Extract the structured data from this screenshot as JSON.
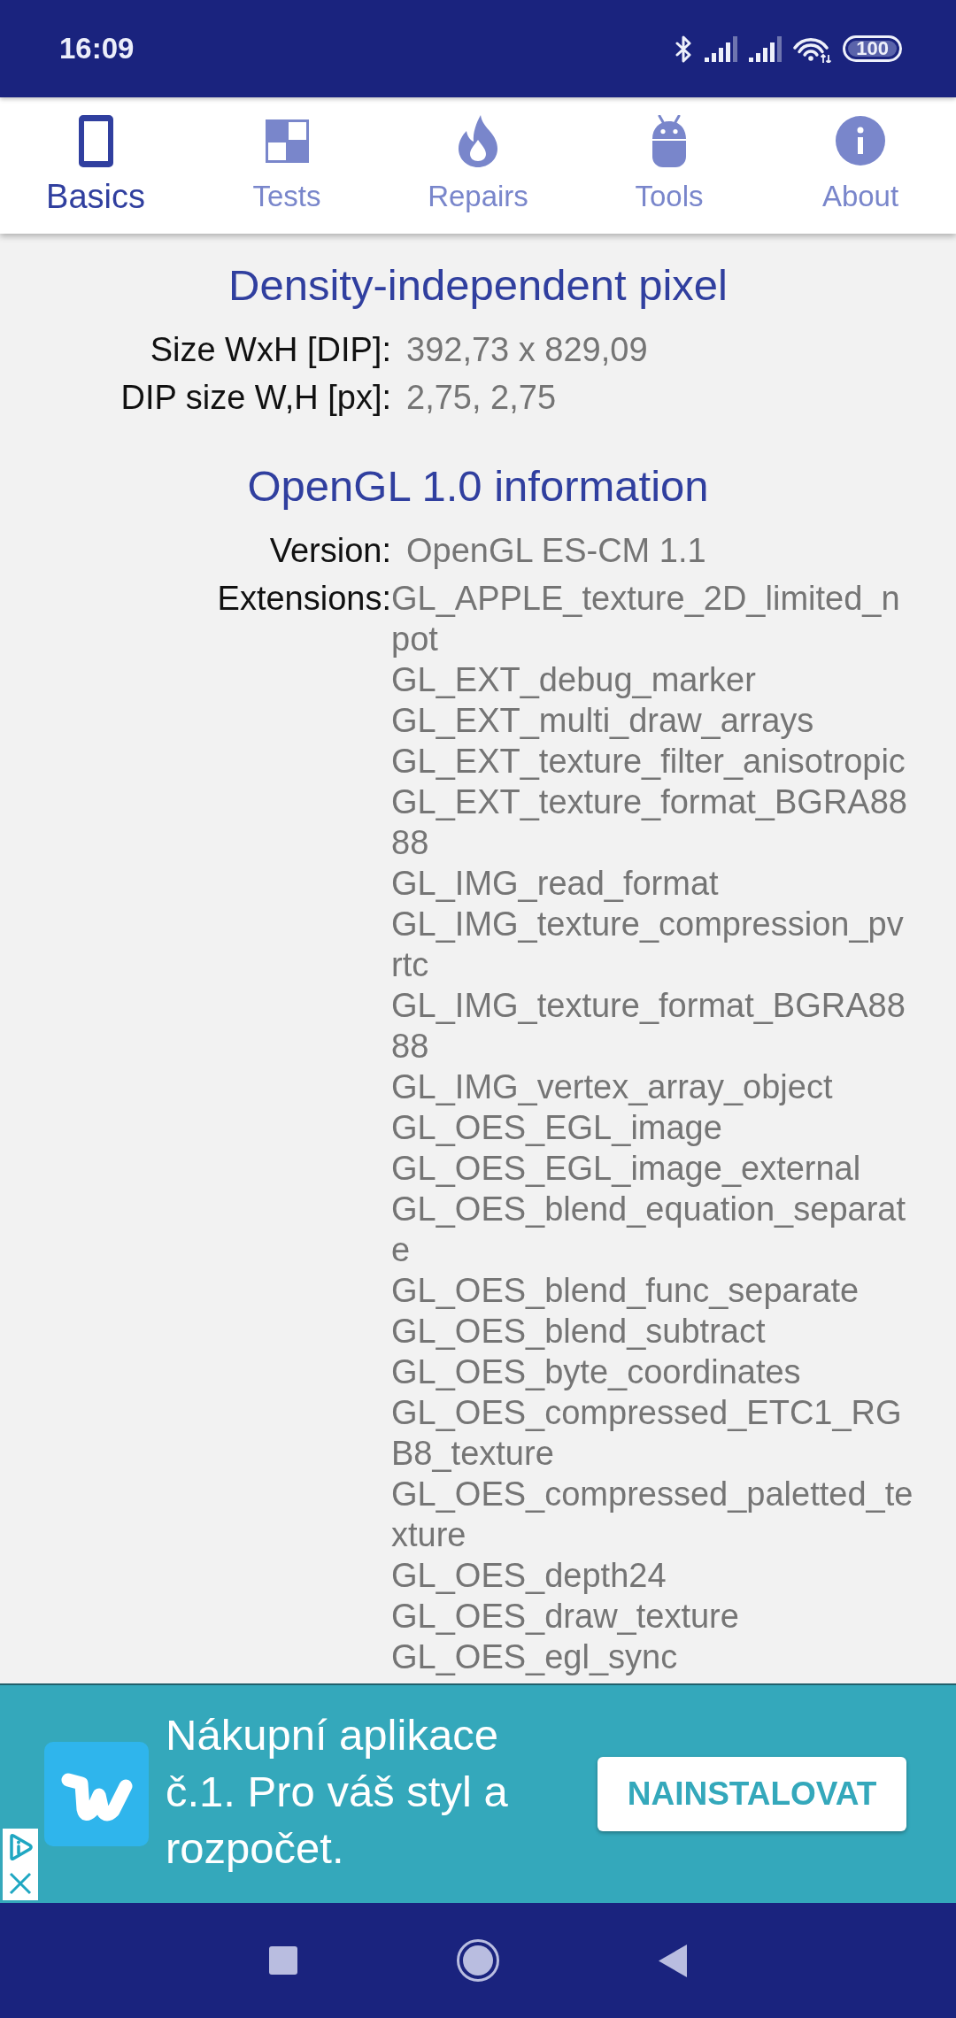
{
  "status_bar": {
    "time": "16:09",
    "battery": "100"
  },
  "tabs": [
    {
      "label": "Basics",
      "selected": true
    },
    {
      "label": "Tests",
      "selected": false
    },
    {
      "label": "Repairs",
      "selected": false
    },
    {
      "label": "Tools",
      "selected": false
    },
    {
      "label": "About",
      "selected": false
    }
  ],
  "sections": [
    {
      "title": "Density-independent pixel",
      "rows": [
        {
          "kind": "text",
          "label": "Size WxH [DIP]:",
          "value": "392,73 x 829,09"
        },
        {
          "kind": "text",
          "label": "DIP size W,H [px]:",
          "value": "2,75, 2,75"
        }
      ]
    },
    {
      "title": "OpenGL 1.0 information",
      "rows": [
        {
          "kind": "text",
          "label": "Version:",
          "value": "OpenGL ES-CM 1.1"
        },
        {
          "kind": "list",
          "label": "Extensions:",
          "items": [
            "GL_APPLE_texture_2D_limited_npot",
            "GL_EXT_debug_marker",
            "GL_EXT_multi_draw_arrays",
            "GL_EXT_texture_filter_anisotropic",
            "GL_EXT_texture_format_BGRA8888",
            "GL_IMG_read_format",
            "GL_IMG_texture_compression_pvrtc",
            "GL_IMG_texture_format_BGRA8888",
            "GL_IMG_vertex_array_object",
            "GL_OES_EGL_image",
            "GL_OES_EGL_image_external",
            "GL_OES_blend_equation_separate",
            "GL_OES_blend_func_separate",
            "GL_OES_blend_subtract",
            "GL_OES_byte_coordinates",
            "GL_OES_compressed_ETC1_RGB8_texture",
            "GL_OES_compressed_paletted_texture",
            "GL_OES_depth24",
            "GL_OES_draw_texture",
            "GL_OES_egl_sync"
          ]
        }
      ]
    }
  ],
  "ad": {
    "text": "Nákupní aplikace č.1. Pro váš styl a rozpočet.",
    "button": "NAINSTALOVAT"
  }
}
